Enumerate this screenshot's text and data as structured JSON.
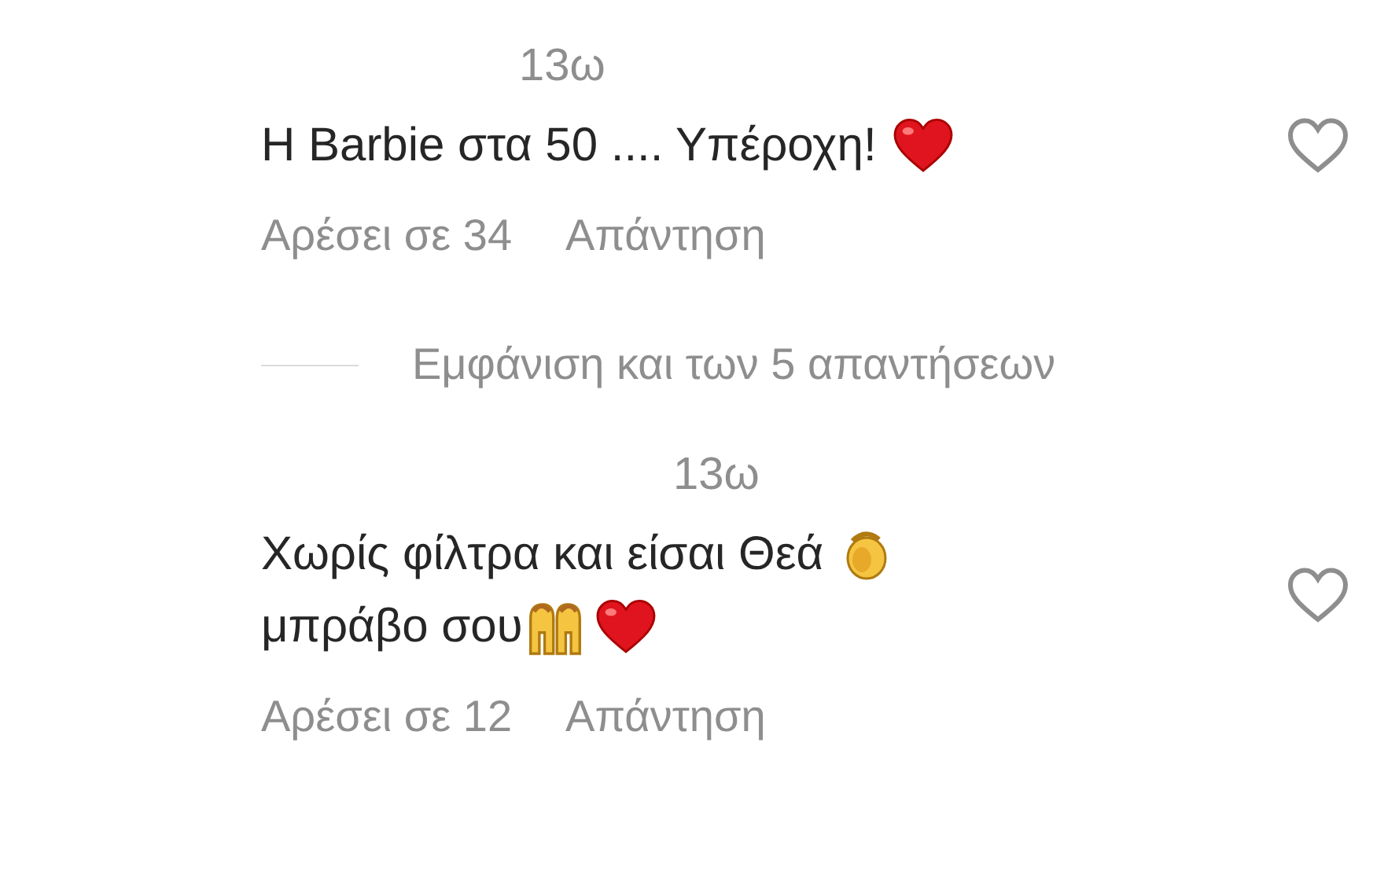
{
  "comments": [
    {
      "time": "13ω",
      "body": [
        {
          "kind": "text",
          "text": "Η Barbie στα 50 .... Υπέροχη!"
        },
        {
          "kind": "heart"
        }
      ],
      "likes": "Αρέσει σε 34",
      "reply": "Απάντηση",
      "liked": false,
      "replies_link": "Εμφάνιση και των 5 απαντήσεων"
    },
    {
      "time": "13ω",
      "body": [
        {
          "kind": "text",
          "text": "Χωρίς φίλτρα και είσαι Θεά"
        },
        {
          "kind": "clap"
        },
        {
          "kind": "break"
        },
        {
          "kind": "text",
          "text": "μπράβο σου"
        },
        {
          "kind": "raised"
        },
        {
          "kind": "heart"
        }
      ],
      "likes": "Αρέσει σε 12",
      "reply": "Απάντηση",
      "liked": false
    }
  ]
}
